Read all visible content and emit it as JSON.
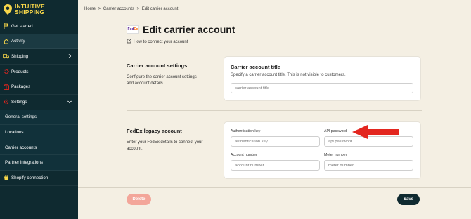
{
  "brand": {
    "line1": "INTUITIVE",
    "line2": "SHIPPING",
    "color": "#f7d64a"
  },
  "sidebar": {
    "items": [
      {
        "label": "Get started",
        "icon": "flag-icon"
      },
      {
        "label": "Activity",
        "icon": "home-icon"
      },
      {
        "label": "Shipping",
        "icon": "truck-icon",
        "chevron": "chevron-right-icon"
      },
      {
        "label": "Products",
        "icon": "tag-icon"
      },
      {
        "label": "Packages",
        "icon": "package-icon"
      },
      {
        "label": "Settings",
        "icon": "gear-icon",
        "chevron": "chevron-down-icon"
      },
      {
        "label": "General settings"
      },
      {
        "label": "Locations"
      },
      {
        "label": "Carrier accounts"
      },
      {
        "label": "Partner integrations"
      },
      {
        "label": "Shopify connection",
        "icon": "shopify-icon"
      }
    ]
  },
  "breadcrumb": {
    "home": "Home",
    "sep1": ">",
    "carriers": "Carrier accounts",
    "sep2": ">",
    "current": "Edit carrier account"
  },
  "header": {
    "logo_fe": "Fed",
    "logo_ex": "Ex",
    "title": "Edit carrier account",
    "howto": "How to connect your account"
  },
  "carrier_settings": {
    "section_title": "Carrier account settings",
    "section_desc": "Configure the carrier account settings and account details.",
    "card_title": "Carrier account title",
    "card_sub": "Specify a carrier account title. This is not visible to customers.",
    "title_placeholder": "carrier account title"
  },
  "fedex": {
    "section_title": "FedEx legacy account",
    "section_desc": "Enter your FedEx details to connect your account.",
    "auth_label": "Authentication key",
    "auth_placeholder": "authentication key",
    "api_label": "API password",
    "api_placeholder": "api password",
    "account_label": "Account number",
    "account_placeholder": "account number",
    "meter_label": "Meter number",
    "meter_placeholder": "meter number"
  },
  "footer": {
    "delete_label": "Delete",
    "save_label": "Save"
  },
  "colors": {
    "sidebar_bg": "#0f2a30",
    "page_bg": "#f4efe3",
    "arrow": "#e3261f",
    "delete_bg": "#f3a69a"
  }
}
